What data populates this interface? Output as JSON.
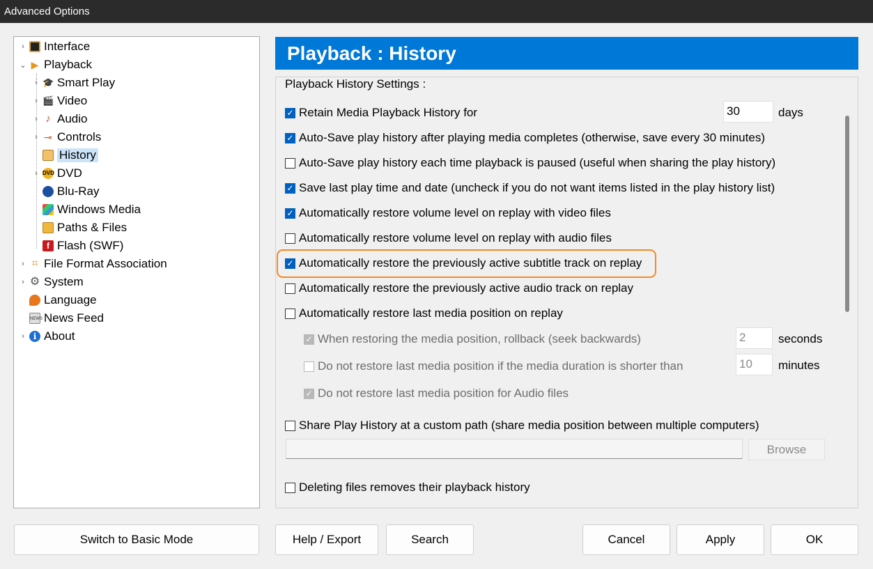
{
  "window": {
    "title": "Advanced Options"
  },
  "tree": {
    "items": [
      {
        "label": "Interface",
        "icon": "interface-icon",
        "level": 0,
        "chevron": "›"
      },
      {
        "label": "Playback",
        "icon": "playback-icon",
        "level": 0,
        "chevron": "⌄"
      },
      {
        "label": "Smart Play",
        "icon": "smart-play-icon",
        "level": 1,
        "chevron": "›"
      },
      {
        "label": "Video",
        "icon": "video-icon",
        "level": 1,
        "chevron": "›"
      },
      {
        "label": "Audio",
        "icon": "audio-icon",
        "level": 1,
        "chevron": "›"
      },
      {
        "label": "Controls",
        "icon": "controls-icon",
        "level": 1,
        "chevron": "›"
      },
      {
        "label": "History",
        "icon": "history-icon",
        "level": 1,
        "chevron": "",
        "selected": true
      },
      {
        "label": "DVD",
        "icon": "dvd-icon",
        "level": 1,
        "chevron": "›"
      },
      {
        "label": "Blu-Ray",
        "icon": "bluray-icon",
        "level": 1,
        "chevron": ""
      },
      {
        "label": "Windows Media",
        "icon": "windows-media-icon",
        "level": 1,
        "chevron": ""
      },
      {
        "label": "Paths & Files",
        "icon": "folder-icon",
        "level": 1,
        "chevron": ""
      },
      {
        "label": "Flash (SWF)",
        "icon": "flash-icon",
        "level": 1,
        "chevron": ""
      },
      {
        "label": "File Format Association",
        "icon": "file-format-icon",
        "level": 0,
        "chevron": "›"
      },
      {
        "label": "System",
        "icon": "gear-icon",
        "level": 0,
        "chevron": "›"
      },
      {
        "label": "Language",
        "icon": "language-icon",
        "level": 0,
        "chevron": ""
      },
      {
        "label": "News Feed",
        "icon": "news-icon",
        "level": 0,
        "chevron": ""
      },
      {
        "label": "About",
        "icon": "info-icon",
        "level": 0,
        "chevron": "›"
      }
    ]
  },
  "header": {
    "title": "Playback : History"
  },
  "group": {
    "title": "Playback History Settings :",
    "retain_label": "Retain Media Playback History for",
    "retain_value": "30",
    "retain_unit": "days",
    "options": [
      {
        "label": "Auto-Save play history after playing media completes (otherwise, save every 30 minutes)",
        "checked": true
      },
      {
        "label": "Auto-Save play history each time playback is paused (useful when sharing the play history)",
        "checked": false
      },
      {
        "label": "Save last play time and date (uncheck if you do not want items listed in the play history list)",
        "checked": true
      },
      {
        "label": "Automatically restore volume level on replay with video files",
        "checked": true
      },
      {
        "label": "Automatically restore volume level on replay with audio files",
        "checked": false
      },
      {
        "label": "Automatically restore the previously active subtitle track on replay",
        "checked": true
      },
      {
        "label": "Automatically restore the previously active audio track on replay",
        "checked": false
      },
      {
        "label": "Automatically restore last media position on replay",
        "checked": false
      }
    ],
    "rollback_label": "When restoring the media position, rollback (seek backwards)",
    "rollback_value": "2",
    "rollback_unit": "seconds",
    "shorter_label": "Do not restore last media position if the media duration is shorter than",
    "shorter_value": "10",
    "shorter_unit": "minutes",
    "audio_files_label": "Do not restore last media position for Audio files",
    "share_label": "Share Play History at a custom path (share media position between multiple computers)",
    "share_path": "",
    "browse_label": "Browse",
    "delete_label": "Deleting files removes their playback history"
  },
  "buttons": {
    "basic_mode": "Switch to Basic Mode",
    "help_export": "Help / Export",
    "search": "Search",
    "cancel": "Cancel",
    "apply": "Apply",
    "ok": "OK"
  },
  "colors": {
    "header_blue": "#0078d7",
    "checkbox_blue": "#0060c0",
    "highlight_orange": "#f08a24",
    "titlebar": "#2b2b2b"
  }
}
